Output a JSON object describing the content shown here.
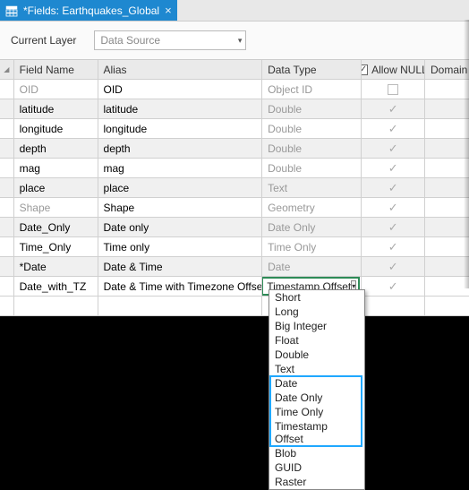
{
  "tab": {
    "title": "*Fields: Earthquakes_Global"
  },
  "toolbar": {
    "label": "Current Layer",
    "dropdown_value": "Data Source"
  },
  "columns": {
    "field_name": "Field Name",
    "alias": "Alias",
    "data_type": "Data Type",
    "allow_null": "Allow NULL",
    "domain": "Domain"
  },
  "rows": [
    {
      "field": "OID",
      "alias": "OID",
      "type": "Object ID",
      "null": "empty",
      "dimField": true,
      "dimType": true
    },
    {
      "field": "latitude",
      "alias": "latitude",
      "type": "Double",
      "null": "check",
      "dimType": true
    },
    {
      "field": "longitude",
      "alias": "longitude",
      "type": "Double",
      "null": "check",
      "dimType": true
    },
    {
      "field": "depth",
      "alias": "depth",
      "type": "Double",
      "null": "check",
      "dimType": true
    },
    {
      "field": "mag",
      "alias": "mag",
      "type": "Double",
      "null": "check",
      "dimType": true
    },
    {
      "field": "place",
      "alias": "place",
      "type": "Text",
      "null": "check",
      "dimType": true
    },
    {
      "field": "Shape",
      "alias": "Shape",
      "type": "Geometry",
      "null": "check",
      "dimField": true,
      "dimType": true
    },
    {
      "field": "Date_Only",
      "alias": "Date only",
      "type": "Date Only",
      "null": "check",
      "dimType": true
    },
    {
      "field": "Time_Only",
      "alias": "Time only",
      "type": "Time Only",
      "null": "check",
      "dimType": true
    },
    {
      "field": "*Date",
      "alias": "Date & Time",
      "type": "Date",
      "null": "check",
      "dimType": true
    },
    {
      "field": "Date_with_TZ",
      "alias": "Date & Time with Timezone Offset",
      "type": "Timestamp Offset",
      "null": "check",
      "editor": true
    }
  ],
  "type_options": [
    "Short",
    "Long",
    "Big Integer",
    "Float",
    "Double",
    "Text",
    "Date",
    "Date Only",
    "Time Only",
    "Timestamp Offset",
    "Blob",
    "GUID",
    "Raster"
  ]
}
